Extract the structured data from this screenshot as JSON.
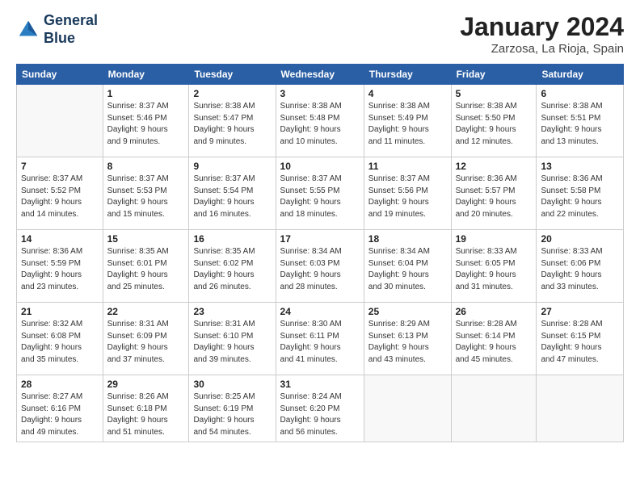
{
  "logo": {
    "line1": "General",
    "line2": "Blue"
  },
  "title": "January 2024",
  "subtitle": "Zarzosa, La Rioja, Spain",
  "days_of_week": [
    "Sunday",
    "Monday",
    "Tuesday",
    "Wednesday",
    "Thursday",
    "Friday",
    "Saturday"
  ],
  "weeks": [
    [
      {
        "day": "",
        "info": ""
      },
      {
        "day": "1",
        "info": "Sunrise: 8:37 AM\nSunset: 5:46 PM\nDaylight: 9 hours\nand 9 minutes."
      },
      {
        "day": "2",
        "info": "Sunrise: 8:38 AM\nSunset: 5:47 PM\nDaylight: 9 hours\nand 9 minutes."
      },
      {
        "day": "3",
        "info": "Sunrise: 8:38 AM\nSunset: 5:48 PM\nDaylight: 9 hours\nand 10 minutes."
      },
      {
        "day": "4",
        "info": "Sunrise: 8:38 AM\nSunset: 5:49 PM\nDaylight: 9 hours\nand 11 minutes."
      },
      {
        "day": "5",
        "info": "Sunrise: 8:38 AM\nSunset: 5:50 PM\nDaylight: 9 hours\nand 12 minutes."
      },
      {
        "day": "6",
        "info": "Sunrise: 8:38 AM\nSunset: 5:51 PM\nDaylight: 9 hours\nand 13 minutes."
      }
    ],
    [
      {
        "day": "7",
        "info": "Sunrise: 8:37 AM\nSunset: 5:52 PM\nDaylight: 9 hours\nand 14 minutes."
      },
      {
        "day": "8",
        "info": "Sunrise: 8:37 AM\nSunset: 5:53 PM\nDaylight: 9 hours\nand 15 minutes."
      },
      {
        "day": "9",
        "info": "Sunrise: 8:37 AM\nSunset: 5:54 PM\nDaylight: 9 hours\nand 16 minutes."
      },
      {
        "day": "10",
        "info": "Sunrise: 8:37 AM\nSunset: 5:55 PM\nDaylight: 9 hours\nand 18 minutes."
      },
      {
        "day": "11",
        "info": "Sunrise: 8:37 AM\nSunset: 5:56 PM\nDaylight: 9 hours\nand 19 minutes."
      },
      {
        "day": "12",
        "info": "Sunrise: 8:36 AM\nSunset: 5:57 PM\nDaylight: 9 hours\nand 20 minutes."
      },
      {
        "day": "13",
        "info": "Sunrise: 8:36 AM\nSunset: 5:58 PM\nDaylight: 9 hours\nand 22 minutes."
      }
    ],
    [
      {
        "day": "14",
        "info": "Sunrise: 8:36 AM\nSunset: 5:59 PM\nDaylight: 9 hours\nand 23 minutes."
      },
      {
        "day": "15",
        "info": "Sunrise: 8:35 AM\nSunset: 6:01 PM\nDaylight: 9 hours\nand 25 minutes."
      },
      {
        "day": "16",
        "info": "Sunrise: 8:35 AM\nSunset: 6:02 PM\nDaylight: 9 hours\nand 26 minutes."
      },
      {
        "day": "17",
        "info": "Sunrise: 8:34 AM\nSunset: 6:03 PM\nDaylight: 9 hours\nand 28 minutes."
      },
      {
        "day": "18",
        "info": "Sunrise: 8:34 AM\nSunset: 6:04 PM\nDaylight: 9 hours\nand 30 minutes."
      },
      {
        "day": "19",
        "info": "Sunrise: 8:33 AM\nSunset: 6:05 PM\nDaylight: 9 hours\nand 31 minutes."
      },
      {
        "day": "20",
        "info": "Sunrise: 8:33 AM\nSunset: 6:06 PM\nDaylight: 9 hours\nand 33 minutes."
      }
    ],
    [
      {
        "day": "21",
        "info": "Sunrise: 8:32 AM\nSunset: 6:08 PM\nDaylight: 9 hours\nand 35 minutes."
      },
      {
        "day": "22",
        "info": "Sunrise: 8:31 AM\nSunset: 6:09 PM\nDaylight: 9 hours\nand 37 minutes."
      },
      {
        "day": "23",
        "info": "Sunrise: 8:31 AM\nSunset: 6:10 PM\nDaylight: 9 hours\nand 39 minutes."
      },
      {
        "day": "24",
        "info": "Sunrise: 8:30 AM\nSunset: 6:11 PM\nDaylight: 9 hours\nand 41 minutes."
      },
      {
        "day": "25",
        "info": "Sunrise: 8:29 AM\nSunset: 6:13 PM\nDaylight: 9 hours\nand 43 minutes."
      },
      {
        "day": "26",
        "info": "Sunrise: 8:28 AM\nSunset: 6:14 PM\nDaylight: 9 hours\nand 45 minutes."
      },
      {
        "day": "27",
        "info": "Sunrise: 8:28 AM\nSunset: 6:15 PM\nDaylight: 9 hours\nand 47 minutes."
      }
    ],
    [
      {
        "day": "28",
        "info": "Sunrise: 8:27 AM\nSunset: 6:16 PM\nDaylight: 9 hours\nand 49 minutes."
      },
      {
        "day": "29",
        "info": "Sunrise: 8:26 AM\nSunset: 6:18 PM\nDaylight: 9 hours\nand 51 minutes."
      },
      {
        "day": "30",
        "info": "Sunrise: 8:25 AM\nSunset: 6:19 PM\nDaylight: 9 hours\nand 54 minutes."
      },
      {
        "day": "31",
        "info": "Sunrise: 8:24 AM\nSunset: 6:20 PM\nDaylight: 9 hours\nand 56 minutes."
      },
      {
        "day": "",
        "info": ""
      },
      {
        "day": "",
        "info": ""
      },
      {
        "day": "",
        "info": ""
      }
    ]
  ]
}
